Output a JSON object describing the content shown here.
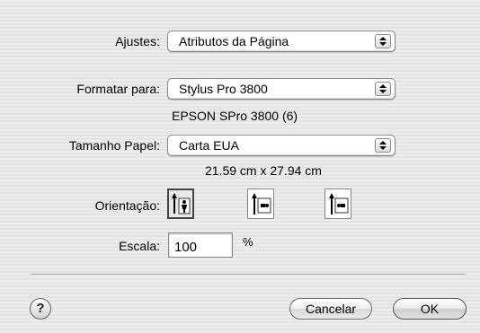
{
  "ajustes": {
    "label": "Ajustes:",
    "value": "Atributos da Página"
  },
  "formatar": {
    "label": "Formatar para:",
    "value": "Stylus Pro 3800",
    "printer_info": "EPSON SPro 3800 (6)"
  },
  "tamanho": {
    "label": "Tamanho Papel:",
    "value": "Carta EUA",
    "dimensions": "21.59 cm x 27.94 cm"
  },
  "orientacao": {
    "label": "Orientação:",
    "options": [
      "portrait",
      "landscape-left",
      "landscape-right"
    ],
    "selected": "portrait"
  },
  "escala": {
    "label": "Escala:",
    "value": "100",
    "unit": "%"
  },
  "help": {
    "label": "?"
  },
  "buttons": {
    "cancel": "Cancelar",
    "ok": "OK"
  }
}
